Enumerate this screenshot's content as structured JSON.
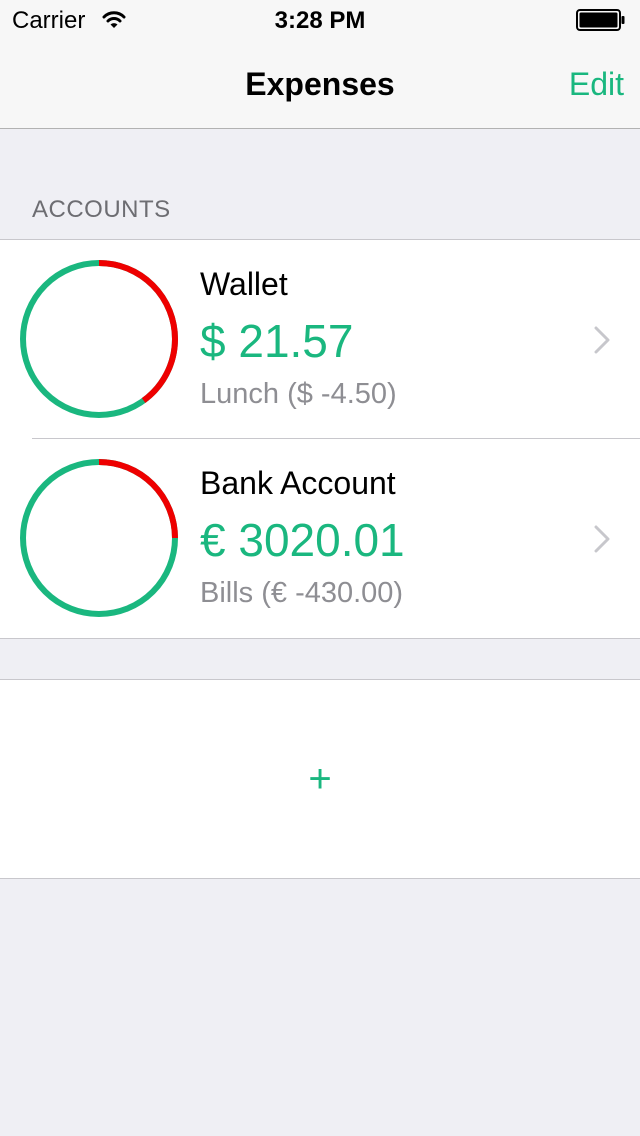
{
  "status_bar": {
    "carrier": "Carrier",
    "time": "3:28 PM",
    "wifi_icon": "wifi-icon",
    "battery_icon": "battery-icon"
  },
  "nav": {
    "title": "Expenses",
    "edit_label": "Edit"
  },
  "section_header": "ACCOUNTS",
  "accounts": [
    {
      "name": "Wallet",
      "balance": "$ 21.57",
      "last_transaction": "Lunch ($ -4.50)",
      "ring_spent_fraction": 0.4,
      "chevron_icon": "chevron-right-icon"
    },
    {
      "name": "Bank Account",
      "balance": "€ 3020.01",
      "last_transaction": "Bills (€ -430.00)",
      "ring_spent_fraction": 0.25,
      "chevron_icon": "chevron-right-icon"
    }
  ],
  "add_label": "+",
  "colors": {
    "accent": "#1ab77f",
    "spent": "#ee0000",
    "background": "#efeff4",
    "secondary_text": "#8e8e93"
  }
}
